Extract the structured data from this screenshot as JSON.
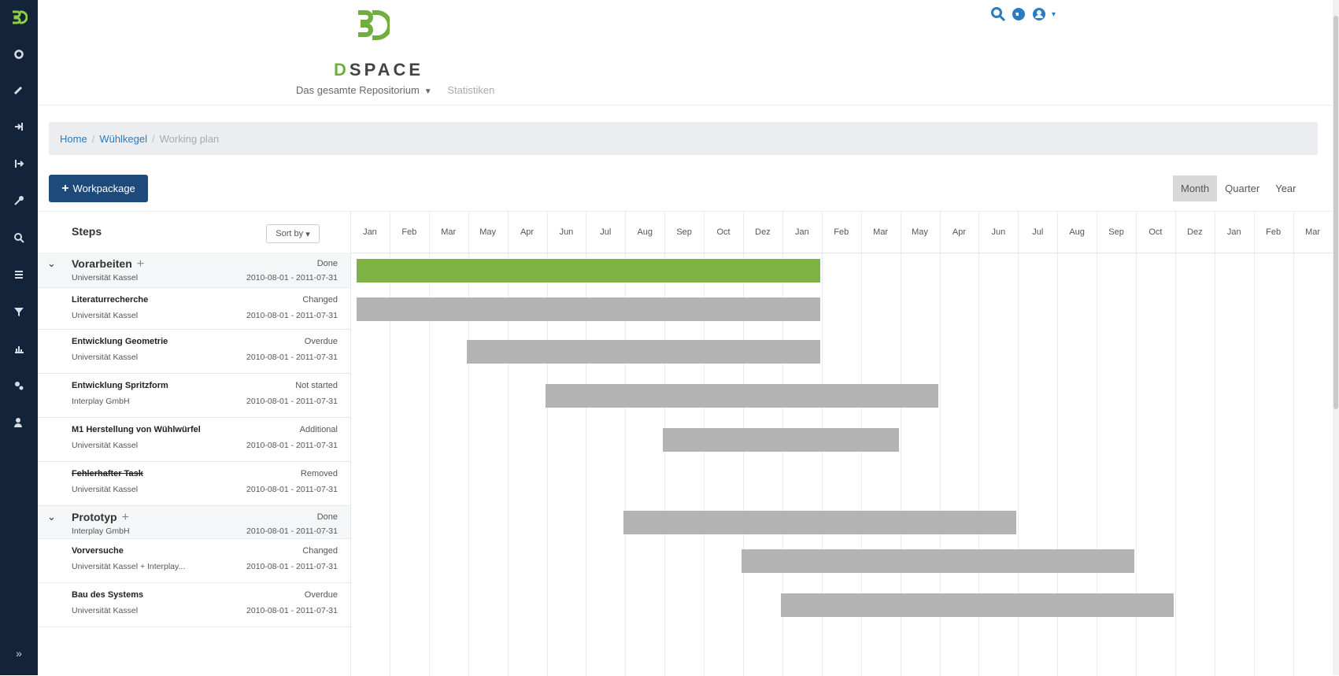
{
  "colors": {
    "sidebar": "#13233a",
    "accent": "#1d4a7b",
    "link": "#2b7bbf",
    "brand_green": "#6fae3f",
    "bar_done": "#7fb244",
    "bar_default": "#b3b3b3"
  },
  "sidebar": {
    "icons": [
      "dspace-logo-icon",
      "gear-icon",
      "pencil-icon",
      "login-icon",
      "logout-icon",
      "key-icon",
      "search-icon",
      "list-icon",
      "filter-icon",
      "chart-icon",
      "settings-icon",
      "user-icon"
    ],
    "expand_label": "»"
  },
  "header": {
    "logo_first": "D",
    "logo_rest": "SPACE",
    "nav_repository": "Das gesamte Repositorium",
    "nav_caret": "▼",
    "nav_statistics": "Statistiken",
    "caret": "▾"
  },
  "breadcrumb": {
    "home": "Home",
    "parent": "Wühlkegel",
    "current": "Working plan"
  },
  "toolbar": {
    "add_label": "Workpackage",
    "add_icon": "+"
  },
  "view_toggle": [
    "Month",
    "Quarter",
    "Year"
  ],
  "view_active": "Month",
  "steps": {
    "title": "Steps",
    "sort_label": "Sort by",
    "sort_caret": "▾",
    "rows": [
      {
        "name": "Vorarbeiten",
        "org": "Universität Kassel",
        "status": "Done",
        "dates": "2010-08-01 - 2011-07-31",
        "group": true
      },
      {
        "name": "Literaturrecherche",
        "org": "Universität Kassel",
        "status": "Changed",
        "dates": "2010-08-01 - 2011-07-31"
      },
      {
        "name": "Entwicklung Geometrie",
        "org": "Universität Kassel",
        "status": "Overdue",
        "dates": "2010-08-01 - 2011-07-31"
      },
      {
        "name": "Entwicklung Spritzform",
        "org": "Interplay GmbH",
        "status": "Not started",
        "dates": "2010-08-01 - 2011-07-31"
      },
      {
        "name": "M1 Herstellung von Wühlwürfel",
        "org": "Universität Kassel",
        "status": "Additional",
        "dates": "2010-08-01 - 2011-07-31"
      },
      {
        "name": "Fehlerhafter Task",
        "org": "Universität Kassel",
        "status": "Removed",
        "dates": "2010-08-01 - 2011-07-31",
        "struck": true
      },
      {
        "name": "Prototyp",
        "org": "Interplay GmbH",
        "status": "Done",
        "dates": "2010-08-01 - 2011-07-31",
        "group": true
      },
      {
        "name": "Vorversuche",
        "org": "Universität Kassel + Interplay...",
        "status": "Changed",
        "dates": "2010-08-01 - 2011-07-31"
      },
      {
        "name": "Bau des Systems",
        "org": "Universität Kassel",
        "status": "Overdue",
        "dates": "2010-08-01 - 2011-07-31"
      }
    ]
  },
  "timeline": {
    "months": [
      "Jan",
      "Feb",
      "Mar",
      "May",
      "Apr",
      "Jun",
      "Jul",
      "Aug",
      "Sep",
      "Oct",
      "Dez",
      "Jan",
      "Feb",
      "Mar",
      "May",
      "Apr",
      "Jun",
      "Jul",
      "Aug",
      "Sep",
      "Oct",
      "Dez",
      "Jan",
      "Feb",
      "Mar"
    ],
    "bars": [
      {
        "start": 0,
        "end": 11.8,
        "color": "#7fb244"
      },
      {
        "start": 0,
        "end": 11.8,
        "color": "#b3b3b3"
      },
      {
        "start": 2.8,
        "end": 11.8,
        "color": "#b3b3b3"
      },
      {
        "start": 4.8,
        "end": 14.8,
        "color": "#b3b3b3"
      },
      {
        "start": 7.8,
        "end": 13.8,
        "color": "#b3b3b3"
      },
      null,
      {
        "start": 6.8,
        "end": 16.8,
        "color": "#b3b3b3"
      },
      {
        "start": 9.8,
        "end": 19.8,
        "color": "#b3b3b3"
      },
      {
        "start": 10.8,
        "end": 20.8,
        "color": "#b3b3b3"
      }
    ]
  }
}
